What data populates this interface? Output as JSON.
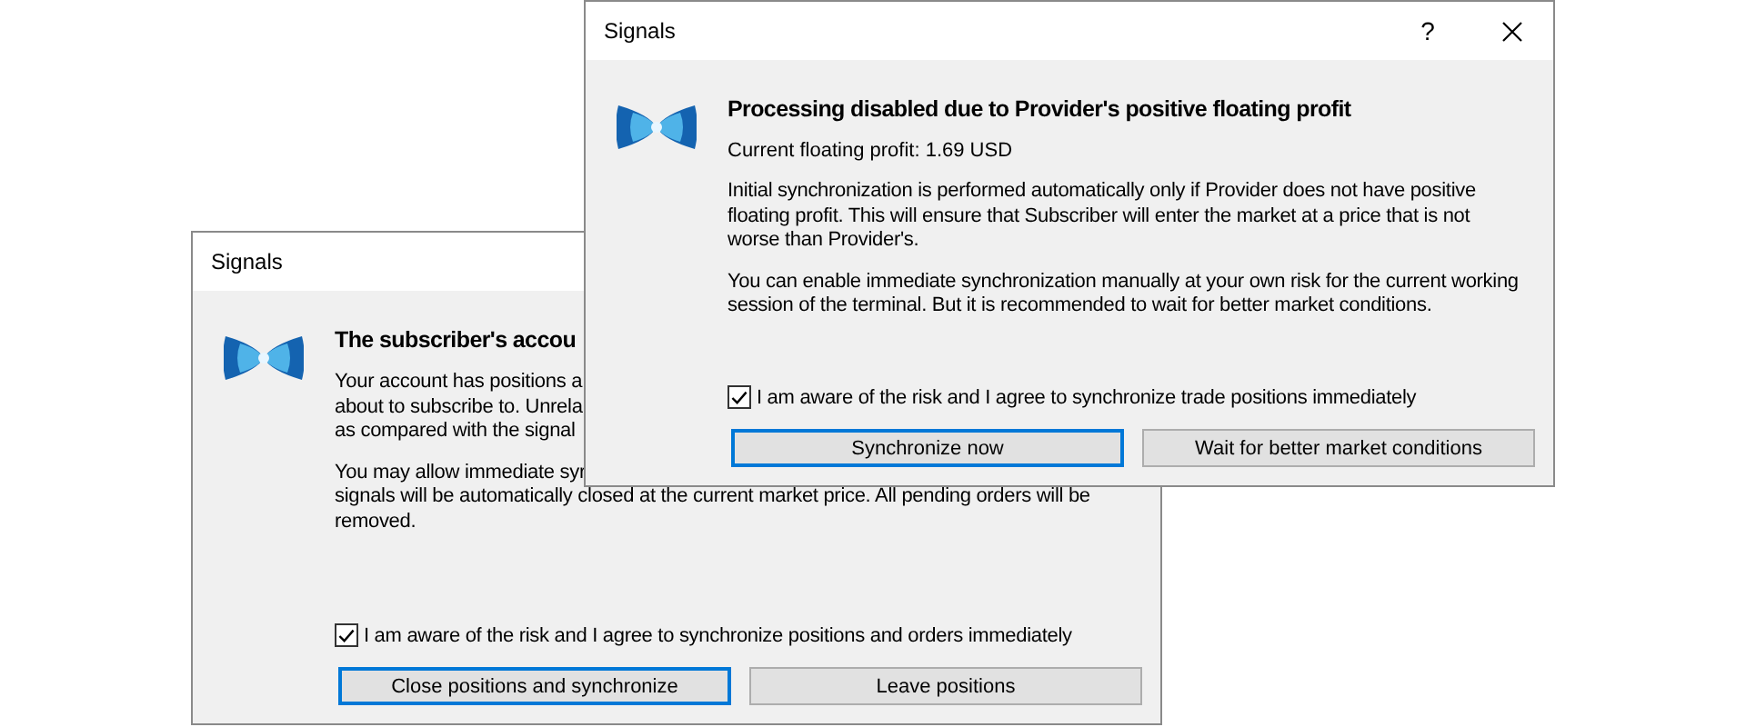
{
  "windows": [
    {
      "title": "Signals",
      "help": "?",
      "has_close": true,
      "heading": "Processing disabled due to Provider's positive floating profit",
      "subtitle": "Current floating profit: 1.69 USD",
      "paragraphs": [
        [
          "Initial synchronization is performed automatically only if Provider does not have positive",
          "floating profit. This will ensure that Subscriber will enter the market at a price that is not",
          "worse than Provider's."
        ],
        [
          "You can enable immediate synchronization manually at your own risk for the current working",
          "session of the terminal. But it is recommended to wait for better market conditions."
        ]
      ],
      "checkbox": {
        "label": "I am aware of the risk and I agree to synchronize trade positions immediately",
        "checked": true
      },
      "buttons": [
        {
          "label": "Synchronize now",
          "default": true
        },
        {
          "label": "Wait for better market conditions",
          "default": false
        }
      ]
    },
    {
      "title": "Signals",
      "heading": "The subscriber's accou",
      "paragraphs": [
        [
          "Your account has positions a",
          "about to subscribe to. Unrela",
          "as compared with the signal"
        ],
        [
          "You may allow immediate syr",
          "signals will be automatically closed at the current market price. All pending orders will be",
          "removed."
        ]
      ],
      "checkbox": {
        "label": "I am aware of the risk and I agree to synchronize positions and orders immediately",
        "checked": true
      },
      "buttons": [
        {
          "label": "Close positions and synchronize",
          "default": true
        },
        {
          "label": "Leave positions",
          "default": false
        }
      ]
    }
  ]
}
